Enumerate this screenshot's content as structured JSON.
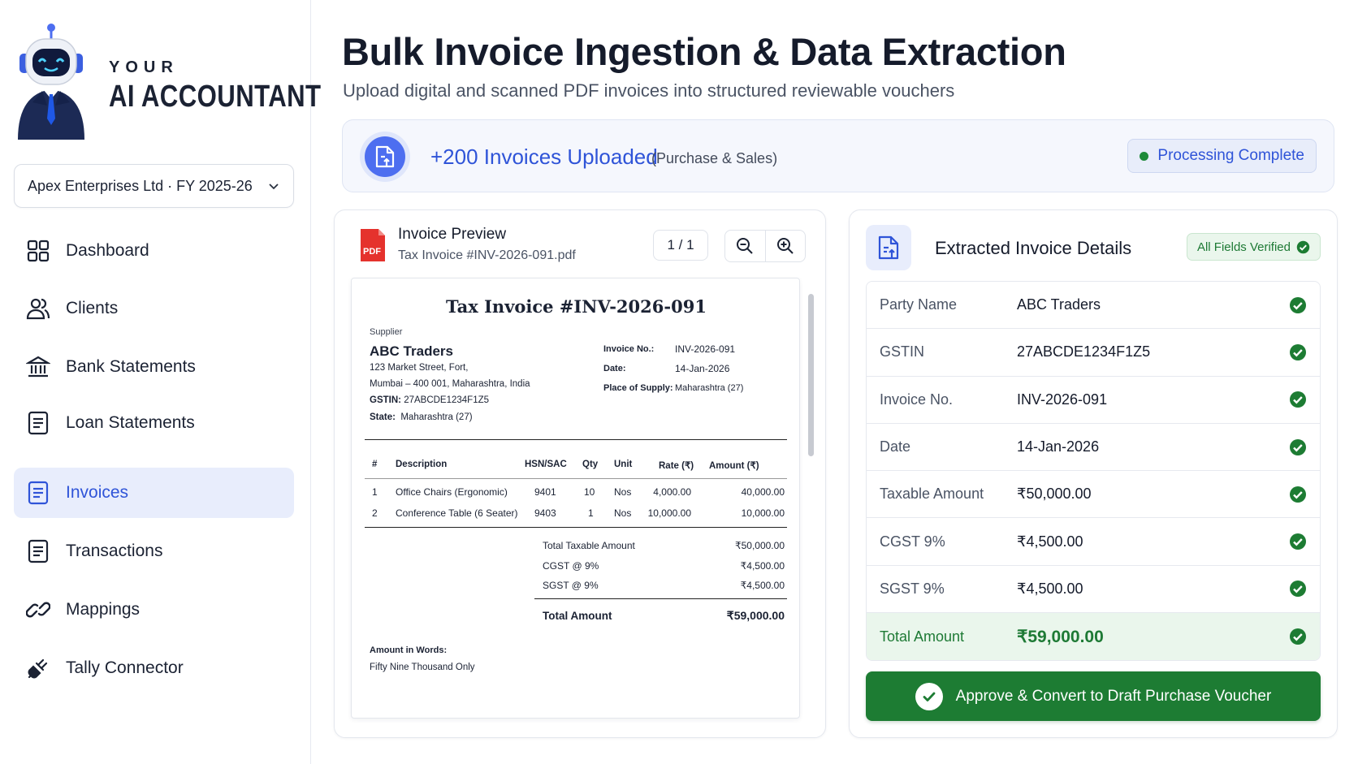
{
  "brand": {
    "line1": "YOUR",
    "line2": "AI ACCOUNTANT"
  },
  "company_selector": {
    "value": "Apex Enterprises Ltd · FY 2025-26"
  },
  "sidebar": {
    "items": [
      {
        "label": "Dashboard",
        "icon": "grid-icon",
        "active": false
      },
      {
        "label": "Clients",
        "icon": "users-icon",
        "active": false
      },
      {
        "label": "Bank Statements",
        "icon": "bank-icon",
        "active": false
      },
      {
        "label": "Loan Statements",
        "icon": "document-icon",
        "active": false
      },
      {
        "label": "Invoices",
        "icon": "document-icon",
        "active": true
      },
      {
        "label": "Transactions",
        "icon": "document-icon",
        "active": false
      },
      {
        "label": "Mappings",
        "icon": "link-icon",
        "active": false
      },
      {
        "label": "Tally Connector",
        "icon": "plug-icon",
        "active": false
      }
    ]
  },
  "header": {
    "title": "Bulk Invoice Ingestion & Data Extraction",
    "subtitle": "Upload digital and scanned PDF invoices into structured reviewable vouchers"
  },
  "upload_banner": {
    "count_text": "+200 Invoices Uploaded",
    "note": "(Purchase & Sales)",
    "status": "Processing Complete"
  },
  "preview": {
    "title": "Invoice Preview",
    "file_name": "Tax Invoice #INV-2026-091.pdf",
    "page_indicator": "1 / 1",
    "pdf_badge": "PDF"
  },
  "invoice_doc": {
    "title": "Tax Invoice #INV-2026-091",
    "supplier_label": "Supplier",
    "supplier_name": "ABC Traders",
    "address_line1": "123 Market Street, Fort,",
    "address_line2": "Mumbai – 400 001, Maharashtra, India",
    "gstin_label": "GSTIN:",
    "gstin_value": "27ABCDE1234F1Z5",
    "state_label": "State:",
    "state_value": "Maharashtra (27)",
    "meta": [
      {
        "label": "Invoice No.:",
        "value": "INV-2026-091"
      },
      {
        "label": "Date:",
        "value": "14-Jan-2026"
      },
      {
        "label": "Place of Supply:",
        "value": "Maharashtra (27)"
      }
    ],
    "columns": [
      "#",
      "Description",
      "HSN/SAC",
      "Qty",
      "Unit",
      "Rate (₹)",
      "Amount (₹)"
    ],
    "rows": [
      [
        "1",
        "Office Chairs (Ergonomic)",
        "9401",
        "10",
        "Nos",
        "4,000.00",
        "40,000.00"
      ],
      [
        "2",
        "Conference Table (6 Seater)",
        "9403",
        "1",
        "Nos",
        "10,000.00",
        "10,000.00"
      ]
    ],
    "totals": [
      {
        "label": "Total Taxable Amount",
        "value": "₹50,000.00"
      },
      {
        "label": "CGST @ 9%",
        "value": "₹4,500.00"
      },
      {
        "label": "SGST @ 9%",
        "value": "₹4,500.00"
      }
    ],
    "grand_total_label": "Total Amount",
    "grand_total_value": "₹59,000.00",
    "words_label": "Amount in Words:",
    "words_value": "Fifty Nine Thousand Only"
  },
  "extracted": {
    "title": "Extracted Invoice Details",
    "verified_badge": "All Fields Verified",
    "fields": [
      {
        "label": "Party Name",
        "value": "ABC Traders"
      },
      {
        "label": "GSTIN",
        "value": "27ABCDE1234F1Z5"
      },
      {
        "label": "Invoice No.",
        "value": "INV-2026-091"
      },
      {
        "label": "Date",
        "value": "14-Jan-2026"
      },
      {
        "label": "Taxable Amount",
        "value": "₹50,000.00"
      },
      {
        "label": "CGST 9%",
        "value": "₹4,500.00"
      },
      {
        "label": "SGST 9%",
        "value": "₹4,500.00"
      },
      {
        "label": "Total Amount",
        "value": "₹59,000.00"
      }
    ],
    "approve_label": "Approve & Convert to Draft Purchase Voucher"
  },
  "colors": {
    "accent": "#2f54d8",
    "success": "#1d7c33",
    "active_bg": "#e8edfc"
  }
}
